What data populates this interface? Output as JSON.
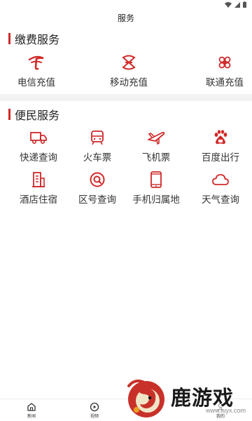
{
  "header": {
    "title": "服务"
  },
  "sections": [
    {
      "title": "缴费服务",
      "items": [
        {
          "label": "电信充值",
          "icon": "china-telecom-icon"
        },
        {
          "label": "移动充值",
          "icon": "china-mobile-icon"
        },
        {
          "label": "联通充值",
          "icon": "china-unicom-icon"
        }
      ]
    },
    {
      "title": "便民服务",
      "items": [
        {
          "label": "快递查询",
          "icon": "delivery-truck-icon"
        },
        {
          "label": "火车票",
          "icon": "train-icon"
        },
        {
          "label": "飞机票",
          "icon": "airplane-icon"
        },
        {
          "label": "百度出行",
          "icon": "baidu-paw-icon"
        },
        {
          "label": "酒店住宿",
          "icon": "hotel-building-icon"
        },
        {
          "label": "区号查询",
          "icon": "area-code-search-icon"
        },
        {
          "label": "手机归属地",
          "icon": "mobile-phone-icon"
        },
        {
          "label": "天气查询",
          "icon": "cloud-icon"
        }
      ]
    }
  ],
  "bottom_nav": [
    {
      "label": "新闻",
      "icon": "home-icon"
    },
    {
      "label": "视频",
      "icon": "play-icon"
    },
    {
      "label": "",
      "icon": ""
    },
    {
      "label": "我的",
      "icon": "user-icon"
    }
  ],
  "watermark": {
    "text": "鹿游戏",
    "url": "www.luyx.com"
  },
  "colors": {
    "accent": "#d02a2a",
    "divider": "#f2f2f2"
  }
}
